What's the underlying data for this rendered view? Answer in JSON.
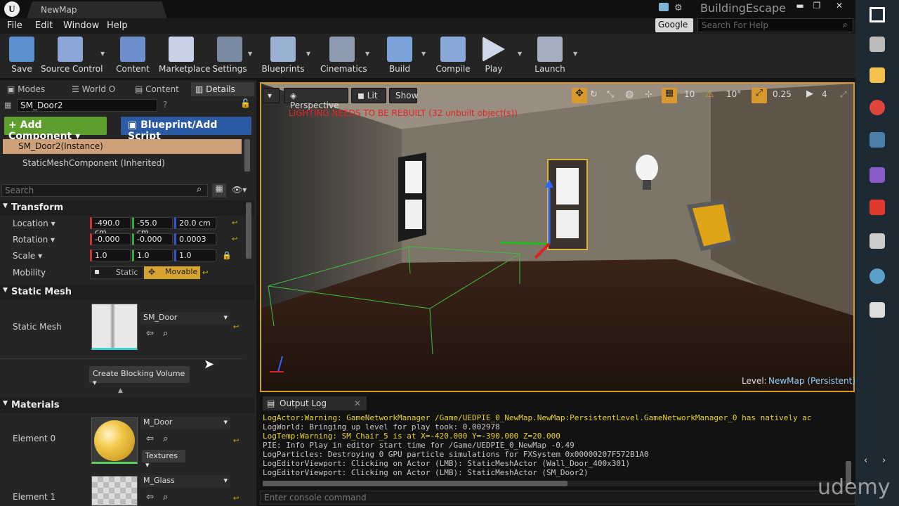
{
  "titlebar": {
    "logo": "U",
    "map_tab": "NewMap",
    "app_title": "BuildingEscape",
    "minimize": "▬",
    "maximize": "❐",
    "close": "✕"
  },
  "menu": [
    "File",
    "Edit",
    "Window",
    "Help"
  ],
  "help": {
    "provider": "Google",
    "search_placeholder": "Search For Help"
  },
  "toolbar": [
    {
      "label": "Save",
      "color": "#5a8fd0"
    },
    {
      "label": "Source Control",
      "color": "#8aa6d6"
    },
    {
      "label": "Content",
      "color": "#6d8fcb"
    },
    {
      "label": "Marketplace",
      "color": "#c9d3e8"
    },
    {
      "label": "Settings",
      "color": "#7a8aa0"
    },
    {
      "label": "Blueprints",
      "color": "#9bb1d2"
    },
    {
      "label": "Cinematics",
      "color": "#8c9bb0"
    },
    {
      "label": "Build",
      "color": "#7da3db"
    },
    {
      "label": "Compile",
      "color": "#88a8d9"
    },
    {
      "label": "Play",
      "color": "#cfd8e8"
    },
    {
      "label": "Launch",
      "color": "#a4b0c2"
    }
  ],
  "panel_tabs": [
    "Modes",
    "World O",
    "Content",
    "Details"
  ],
  "details": {
    "actor_name": "SM_Door2",
    "add_component": "+ Add Component",
    "blueprint_script": "Blueprint/Add Script",
    "components": [
      "SM_Door2(Instance)",
      "StaticMeshComponent (Inherited)"
    ],
    "search_placeholder": "Search",
    "transform": {
      "title": "Transform",
      "location_label": "Location",
      "location": [
        "-490.0 cm",
        "-55.0 cm",
        "20.0 cm"
      ],
      "rotation_label": "Rotation",
      "rotation": [
        "-0.000",
        "-0.000",
        "0.0003"
      ],
      "scale_label": "Scale",
      "scale": [
        "1.0",
        "1.0",
        "1.0"
      ],
      "mobility_label": "Mobility",
      "mobility_options": [
        "Static",
        "Movable"
      ]
    },
    "static_mesh": {
      "title": "Static Mesh",
      "label": "Static Mesh",
      "asset": "SM_Door",
      "create_blocking": "Create Blocking Volume"
    },
    "materials": {
      "title": "Materials",
      "elements": [
        {
          "label": "Element 0",
          "asset": "M_Door",
          "textures": "Textures"
        },
        {
          "label": "Element 1",
          "asset": "M_Glass"
        }
      ]
    }
  },
  "viewport": {
    "perspective": "Perspective",
    "lit": "Lit",
    "show": "Show",
    "grid": "10",
    "angle": "10°",
    "scale": "0.25",
    "camera": "4",
    "warning": "LIGHTING NEEDS TO BE REBUILT (32 unbuilt object(s))",
    "level_label": "Level:",
    "level_name": "NewMap (Persistent)"
  },
  "output_log": {
    "tab": "Output Log",
    "lines": [
      {
        "text": "LogActor:Warning: GameNetworkManager /Game/UEDPIE_0_NewMap.NewMap:PersistentLevel.GameNetworkManager_0 has natively ac",
        "color": "#e8d22a"
      },
      {
        "text": "LogWorld: Bringing up level for play took: 0.002978",
        "color": "#c8c8c8"
      },
      {
        "text": "LogTemp:Warning: SM_Chair_5 is at X=-420.000 Y=-390.000 Z=20.000",
        "color": "#e8d22a"
      },
      {
        "text": "PIE: Info Play in editor start time for /Game/UEDPIE_0_NewMap -0.49",
        "color": "#c8c8c8"
      },
      {
        "text": "LogParticles: Destroying 0 GPU particle simulations for FXSystem 0x00000207F572B1A0",
        "color": "#c8c8c8"
      },
      {
        "text": "LogEditorViewport: Clicking on Actor (LMB): StaticMeshActor (Wall_Door_400x301)",
        "color": "#c8c8c8"
      },
      {
        "text": "LogEditorViewport: Clicking on Actor (LMB): StaticMeshActor (SM_Door2)",
        "color": "#c8c8c8"
      }
    ],
    "console_placeholder": "Enter console command"
  },
  "taskbar": [
    {
      "name": "windows-start-icon",
      "color": "#ffffff"
    },
    {
      "name": "task-view-icon",
      "color": "#bbbbbb"
    },
    {
      "name": "file-explorer-icon",
      "color": "#f2c14e"
    },
    {
      "name": "chrome-icon",
      "color": "#e0463b"
    },
    {
      "name": "steam-icon",
      "color": "#4b7ea8"
    },
    {
      "name": "visual-studio-icon",
      "color": "#8a5cc9"
    },
    {
      "name": "app-icon",
      "color": "#e03a2e"
    },
    {
      "name": "epic-games-icon",
      "color": "#cccccc"
    },
    {
      "name": "globe-app-icon",
      "color": "#5aa0c8"
    },
    {
      "name": "unreal-engine-icon",
      "color": "#dddddd"
    }
  ],
  "watermark": "udemy"
}
